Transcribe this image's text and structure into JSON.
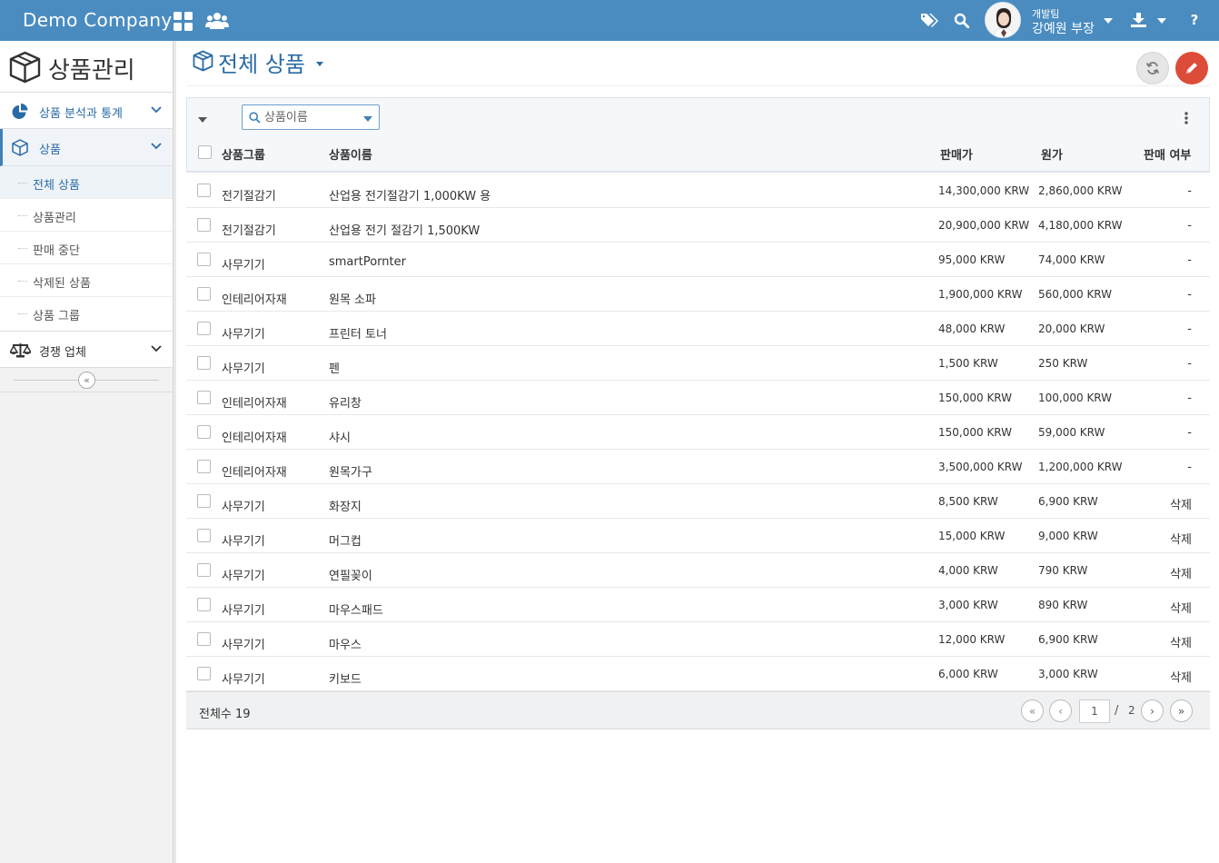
{
  "topbar": {
    "brand": "Demo Company",
    "user_team": "개발팀",
    "user_name": "강예원 부장"
  },
  "icons": {
    "apps": "grid-icon",
    "people": "users-icon",
    "tags": "tags-icon",
    "search": "search-icon",
    "download": "download-icon",
    "help": "question-icon"
  },
  "colors": {
    "header_bg": "#4a8cc0",
    "accent": "#2a6ba5",
    "edit_button": "#dd4b39"
  },
  "sidebar": {
    "title": "상품관리",
    "menus": [
      {
        "label": "상품 분석과 통계"
      },
      {
        "label": "상품"
      },
      {
        "label": "경쟁 업체"
      }
    ],
    "subitems": [
      {
        "label": "전체 상품"
      },
      {
        "label": "상품관리"
      },
      {
        "label": "판매 중단"
      },
      {
        "label": "삭제된 상품"
      },
      {
        "label": "상품 그룹"
      }
    ]
  },
  "main": {
    "title": "전체 상품",
    "search_placeholder": "상품이름"
  },
  "table": {
    "columns": [
      "상품그룹",
      "상품이름",
      "판매가",
      "원가",
      "판매 여부"
    ],
    "rows": [
      {
        "group": "전기절감기",
        "name": "산업용 전기절감기 1,000KW 용",
        "price": "14,300,000 KRW",
        "cost": "2,860,000 KRW",
        "sale": "-"
      },
      {
        "group": "전기절감기",
        "name": "산업용 전기 절감기 1,500KW",
        "price": "20,900,000 KRW",
        "cost": "4,180,000 KRW",
        "sale": "-"
      },
      {
        "group": "사무기기",
        "name": "smartPornter",
        "price": "95,000 KRW",
        "cost": "74,000 KRW",
        "sale": "-"
      },
      {
        "group": "인테리어자재",
        "name": "원목 소파",
        "price": "1,900,000 KRW",
        "cost": "560,000 KRW",
        "sale": "-"
      },
      {
        "group": "사무기기",
        "name": "프린터 토너",
        "price": "48,000 KRW",
        "cost": "20,000 KRW",
        "sale": "-"
      },
      {
        "group": "사무기기",
        "name": "펜",
        "price": "1,500 KRW",
        "cost": "250 KRW",
        "sale": "-"
      },
      {
        "group": "인테리어자재",
        "name": "유리창",
        "price": "150,000 KRW",
        "cost": "100,000 KRW",
        "sale": "-"
      },
      {
        "group": "인테리어자재",
        "name": "샤시",
        "price": "150,000 KRW",
        "cost": "59,000 KRW",
        "sale": "-"
      },
      {
        "group": "인테리어자재",
        "name": "원목가구",
        "price": "3,500,000 KRW",
        "cost": "1,200,000 KRW",
        "sale": "-"
      },
      {
        "group": "사무기기",
        "name": "화장지",
        "price": "8,500 KRW",
        "cost": "6,900 KRW",
        "sale": "삭제"
      },
      {
        "group": "사무기기",
        "name": "머그컵",
        "price": "15,000 KRW",
        "cost": "9,000 KRW",
        "sale": "삭제"
      },
      {
        "group": "사무기기",
        "name": "연필꽂이",
        "price": "4,000 KRW",
        "cost": "790 KRW",
        "sale": "삭제"
      },
      {
        "group": "사무기기",
        "name": "마우스패드",
        "price": "3,000 KRW",
        "cost": "890 KRW",
        "sale": "삭제"
      },
      {
        "group": "사무기기",
        "name": "마우스",
        "price": "12,000 KRW",
        "cost": "6,900 KRW",
        "sale": "삭제"
      },
      {
        "group": "사무기기",
        "name": "키보드",
        "price": "6,000 KRW",
        "cost": "3,000 KRW",
        "sale": "삭제"
      }
    ]
  },
  "footer": {
    "total_label": "전체수 19",
    "current_page": "1",
    "separator": "/",
    "total_pages": "2"
  }
}
